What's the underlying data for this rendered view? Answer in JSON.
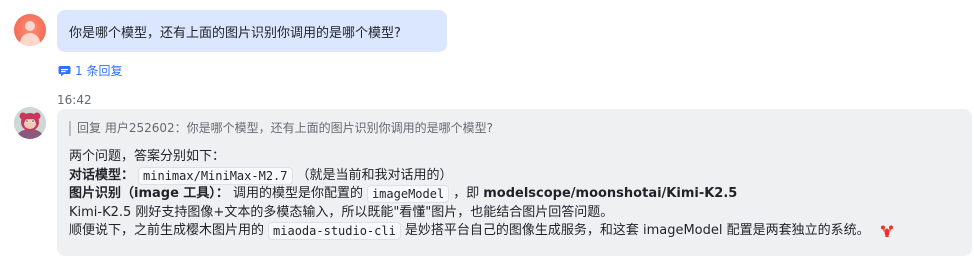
{
  "message1": {
    "text": "你是哪个模型，还有上面的图片识别你调用的是哪个模型?",
    "reply_count": "1 条回复"
  },
  "message2": {
    "time": "16:42",
    "quote": "回复 用户252602：你是哪个模型，还有上面的图片识别你调用的是哪个模型?",
    "line1": "两个问题，答案分别如下：",
    "line2": {
      "label": "对话模型：",
      "code": "minimax/MiniMax-M2.7",
      "text": "（就是当前和我对话用的）"
    },
    "line3": {
      "label": "图片识别（image 工具）：",
      "text_before": "调用的模型是你配置的",
      "code": "imageModel",
      "text_mid": "，即",
      "bold_value": "modelscope/moonshotai/Kimi-K2.5"
    },
    "line4": "Kimi-K2.5 刚好支持图像+文本的多模态输入，所以既能\"看懂\"图片，也能结合图片回答问题。",
    "line5": {
      "text_before": "顺便说下，之前生成樱木图片用的",
      "code": "miaoda-studio-cli",
      "text_after": "是妙搭平台自己的图像生成服务，和这套 imageModel 配置是两套独立的系统。",
      "emoji": "lobster-emoji-icon"
    }
  },
  "colors": {
    "user_bubble": "#dbe6ff",
    "bot_bubble": "#eff0f1",
    "link": "#3370ff",
    "lobster": "#e8352b"
  }
}
